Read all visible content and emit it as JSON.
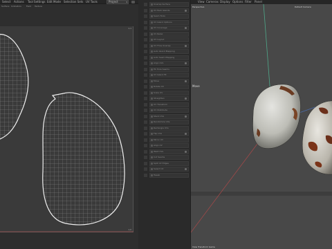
{
  "topbar": {
    "menus": [
      "Select",
      "Actions",
      "Tool Settings",
      "Edit Mode",
      "Selection Sets",
      "UV Tools"
    ],
    "layout_dropdown": "Project",
    "layout_arrow": "▾"
  },
  "uv_editor": {
    "header_items": [
      "Surface",
      "Indicators",
      "Field",
      "Texture"
    ],
    "corner_top_right": "1,1",
    "corner_bottom_right": "1,0"
  },
  "mid_panel": {
    "items": [
      "Unwrap Surface",
      "UV Pack Islands",
      "Seam Tools",
      "UV Island Options",
      "UV Coverage",
      "UV Relax",
      "UV Layout",
      "UV Flow Unwrap",
      "Auto Island Mapping",
      "Auto Seam Mapping",
      "Align UVs",
      "Fill Hole Seams",
      "UV Island Fit",
      "Move",
      "Rotate UV",
      "Scale UV",
      "Straighten",
      "UV Transform",
      "UV Distribute",
      "Stack UVs",
      "Randomize UVs",
      "Rectangle UVs",
      "Flip UVs",
      "Mirror UV",
      "Align UV",
      "Weld UVs",
      "Cut Seams",
      "Split UV Edges",
      "Select UV",
      "Tweak"
    ]
  },
  "viewport": {
    "menus": [
      "View",
      "Cameras",
      "Display",
      "Options",
      "Filter",
      "Panel"
    ],
    "perspective_label": "Perspective",
    "camera_label": "Default Camera",
    "mode_label": "Move",
    "footer_label": "View Transform Game",
    "colors": {
      "background": "#484848",
      "grid_line": "#555555",
      "y_axis": "#4fa88a",
      "x_axis": "#a04848",
      "z_axis": "#4a6cae"
    }
  }
}
